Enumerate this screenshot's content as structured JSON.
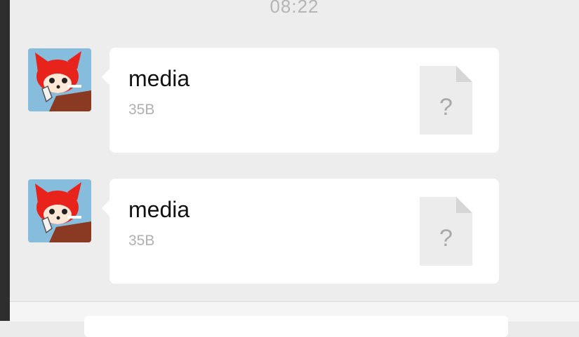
{
  "chat": {
    "timestamp": "08:22",
    "messages": [
      {
        "file_name": "media",
        "file_size": "35B",
        "file_icon_glyph": "?",
        "icon": "unknown-file-icon"
      },
      {
        "file_name": "media",
        "file_size": "35B",
        "file_icon_glyph": "?",
        "icon": "unknown-file-icon"
      }
    ]
  },
  "colors": {
    "background": "#ededed",
    "bubble": "#ffffff",
    "file_size_text": "#b0b0b0",
    "file_icon": "#ececec"
  }
}
